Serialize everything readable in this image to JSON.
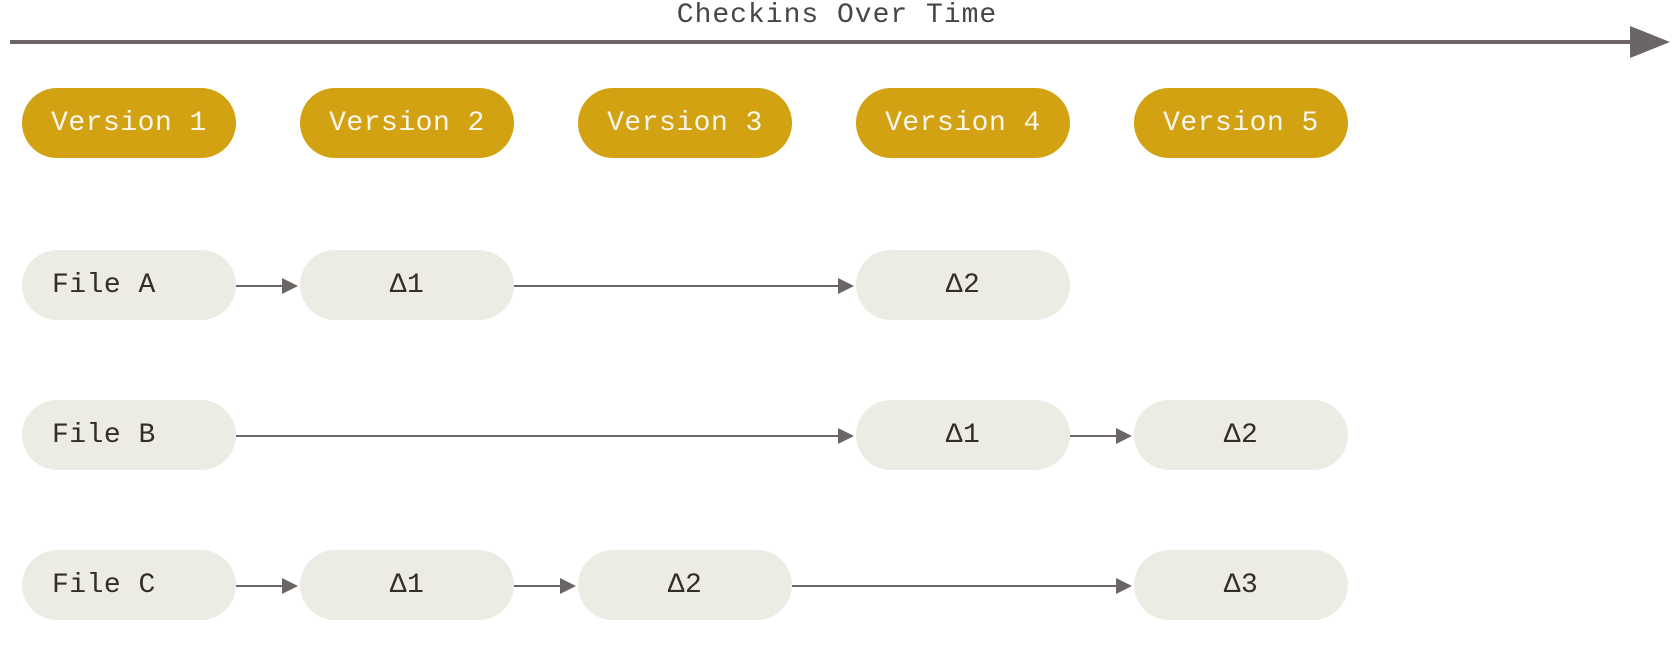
{
  "timeline": {
    "title": "Checkins Over Time"
  },
  "versions": [
    {
      "label": "Version 1"
    },
    {
      "label": "Version 2"
    },
    {
      "label": "Version 3"
    },
    {
      "label": "Version 4"
    },
    {
      "label": "Version 5"
    }
  ],
  "files": [
    {
      "name": "File A",
      "deltas": [
        {
          "col": 1,
          "label": "Δ1"
        },
        {
          "col": 3,
          "label": "Δ2"
        }
      ]
    },
    {
      "name": "File B",
      "deltas": [
        {
          "col": 3,
          "label": "Δ1"
        },
        {
          "col": 4,
          "label": "Δ2"
        }
      ]
    },
    {
      "name": "File C",
      "deltas": [
        {
          "col": 1,
          "label": "Δ1"
        },
        {
          "col": 2,
          "label": "Δ2"
        },
        {
          "col": 4,
          "label": "Δ3"
        }
      ]
    }
  ]
}
